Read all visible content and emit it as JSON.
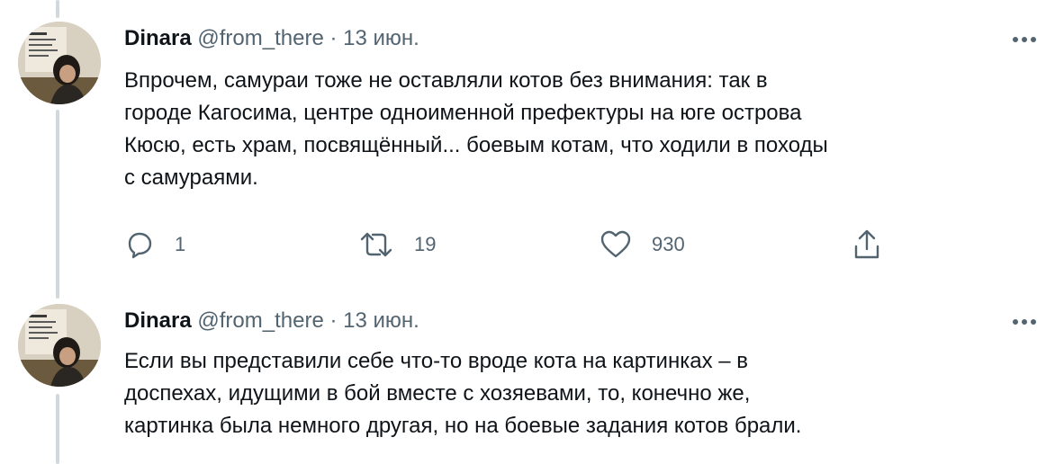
{
  "tweets": [
    {
      "author_name": "Dinara",
      "handle": "@from_there",
      "separator": "·",
      "date": "13 июн.",
      "text": "Впрочем, самураи тоже не оставляли котов без внимания: так в\nгороде Кагосима, центре одноименной префектуры на юге острова\nКюсю, есть храм, посвящённый... боевым котам, что ходили в походы\nс самураями.",
      "replies": "1",
      "retweets": "19",
      "likes": "930"
    },
    {
      "author_name": "Dinara",
      "handle": "@from_there",
      "separator": "·",
      "date": "13 июн.",
      "text": "Если вы представили себе что-то вроде кота на картинках – в\nдоспехах, идущими в бой вместе с хозяевами, то, конечно же,\nкартинка была немного другая, но на боевые задания котов брали."
    }
  ],
  "colors": {
    "text": "#0f1419",
    "secondary": "#536471",
    "thread_line": "#cfd9de"
  },
  "icons": [
    "more-icon",
    "reply-icon",
    "retweet-icon",
    "like-icon",
    "share-icon"
  ]
}
